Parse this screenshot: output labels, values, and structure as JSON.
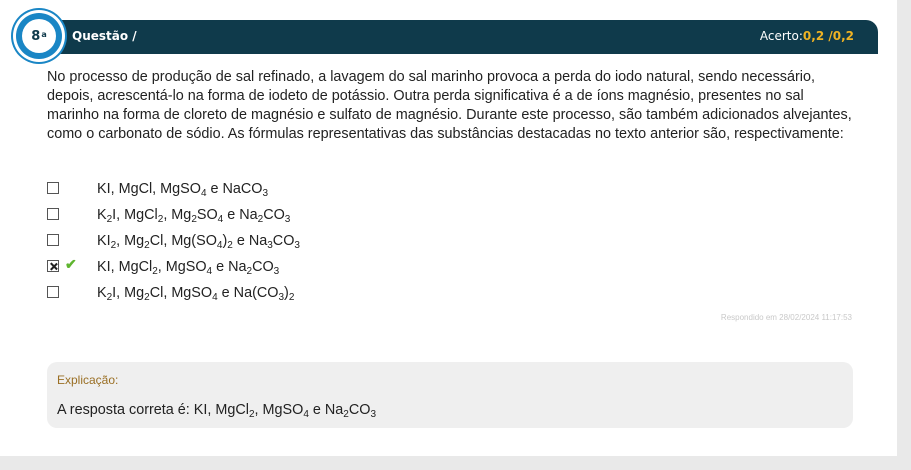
{
  "header": {
    "question_number": "8",
    "question_number_sup": "a",
    "title": "Questão  /",
    "score_label": "Acerto:",
    "score_value": "0,2",
    "score_sep": " /",
    "score_max": "0,2"
  },
  "statement": "No processo de produção de sal refinado, a lavagem do sal marinho provoca a perda do iodo natural, sendo necessário, depois, acrescentá-lo na forma de iodeto de potássio. Outra perda significativa é a de íons magnésio, presentes no sal marinho na forma de cloreto de magnésio e sulfato de magnésio. Durante este processo, são também adicionados alvejantes, como o carbonato de sódio. As fórmulas representativas das substâncias destacadas no texto anterior são, respectivamente:",
  "options": [
    {
      "checked": false,
      "correct": false,
      "parts": [
        "KI, MgCl, MgSO",
        "4",
        " e NaCO",
        "3"
      ]
    },
    {
      "checked": false,
      "correct": false,
      "parts": [
        "K",
        "2",
        "I, MgCl",
        "2",
        ", Mg",
        "2",
        "SO",
        "4",
        " e Na",
        "2",
        "CO",
        "3"
      ]
    },
    {
      "checked": false,
      "correct": false,
      "parts": [
        "KI",
        "2",
        ", Mg",
        "2",
        "Cl, Mg(SO",
        "4",
        ")",
        "2",
        " e Na",
        "3",
        "CO",
        "3"
      ]
    },
    {
      "checked": true,
      "correct": true,
      "parts": [
        "KI, MgCl",
        "2",
        ", MgSO",
        "4",
        " e Na",
        "2",
        "CO",
        "3"
      ]
    },
    {
      "checked": false,
      "correct": false,
      "parts": [
        "K",
        "2",
        "I, Mg",
        "2",
        "Cl, MgSO",
        "4",
        " e Na(CO",
        "3",
        ")",
        "2"
      ]
    }
  ],
  "answered_text": "Respondido em 28/02/2024 11:17:53",
  "explanation": {
    "label": "Explicação:",
    "parts": [
      "A resposta correta é: KI, MgCl",
      "2",
      ", MgSO",
      "4",
      " e Na",
      "2",
      "CO",
      "3"
    ]
  },
  "icons": {
    "correct": "check-icon",
    "checkbox": "checkbox-icon"
  },
  "colors": {
    "header_bg": "#0f3a4b",
    "badge": "#1a86c5",
    "score": "#f0b323",
    "correct": "#5fb52f",
    "explain_label": "#9a6f24"
  }
}
